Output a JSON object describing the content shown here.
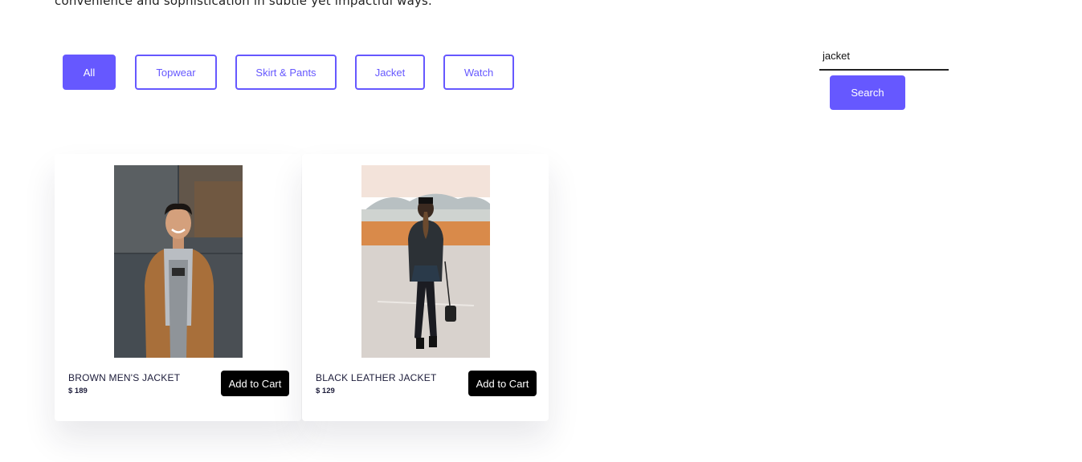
{
  "intro_text": "convenience and sophistication in subtle yet impactful ways.",
  "filters": [
    {
      "label": "All",
      "active": true
    },
    {
      "label": "Topwear",
      "active": false
    },
    {
      "label": "Skirt & Pants",
      "active": false
    },
    {
      "label": "Jacket",
      "active": false
    },
    {
      "label": "Watch",
      "active": false
    }
  ],
  "search": {
    "value": "jacket",
    "button_label": "Search"
  },
  "products": [
    {
      "title": "BROWN MEN'S JACKET",
      "price": "$ 189",
      "button_label": "Add to Cart"
    },
    {
      "title": "BLACK LEATHER JACKET",
      "price": "$ 129",
      "button_label": "Add to Cart"
    }
  ],
  "colors": {
    "accent": "#6658ff",
    "cart_button": "#000000",
    "text_dark": "#1c1c3a"
  }
}
